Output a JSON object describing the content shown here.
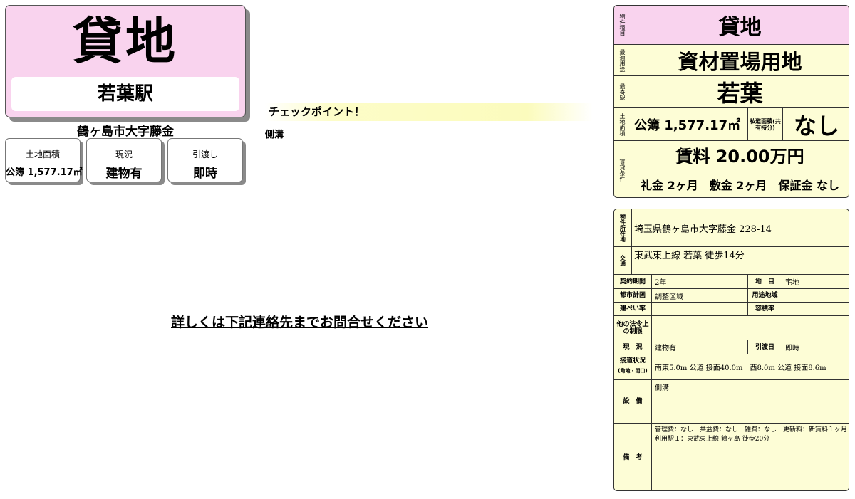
{
  "hero": {
    "type": "貸地",
    "station": "若葉駅",
    "address": "鶴ヶ島市大字藤金"
  },
  "mini_cards": [
    {
      "label": "土地面積",
      "value": "公簿 1,577.17㎡"
    },
    {
      "label": "現況",
      "value": "建物有"
    },
    {
      "label": "引渡し",
      "value": "即時"
    }
  ],
  "checkpoint": {
    "title": "チェックポイント！",
    "body": "側溝"
  },
  "contact_text": "詳しくは下記連絡先までお問合せください",
  "summary": {
    "type_label": "物件種目",
    "type": "貸地",
    "use_label": "最適用途",
    "use": "資材置場用地",
    "station_label": "最寄駅",
    "station": "若葉",
    "area_label": "土地面積",
    "area": "公簿 1,577.17㎡",
    "private_road_label": "私道面積(共有持分)",
    "private_road": "なし",
    "terms_label": "賃貸条件",
    "rent": "賃料 20.00万円",
    "deposits": "礼金 2ヶ月　敷金 2ヶ月　保証金 なし"
  },
  "details": {
    "location_label": "物件所在地",
    "location": "埼玉県鶴ヶ島市大字藤金 228-14",
    "transport_label": "交通",
    "transport": "東武東上線 若葉 徒歩14分",
    "rows": {
      "contract_label": "契約期間",
      "contract": "2年",
      "chimoku_label": "地　目",
      "chimoku": "宅地",
      "city_plan_label": "都市計画",
      "city_plan": "調整区域",
      "zoning_label": "用途地域",
      "zoning": "",
      "bcr_label": "建ぺい率",
      "bcr": "",
      "far_label": "容積率",
      "far": "",
      "restrictions_label": "他の法令上の制限",
      "restrictions": "",
      "status_label": "現　況",
      "status": "建物有",
      "handover_label": "引渡日",
      "handover": "即時",
      "road_label": "接道状況",
      "road_sub": "(角地・間口)",
      "road": "南東5.0m 公道 接面40.0m　西8.0m 公道 接面8.6m",
      "facilities_label": "設　備",
      "facilities": "側溝",
      "remarks_label": "備　考",
      "remarks": "管理費：なし　共益費：なし　雑費：なし　更新料：新賃料１ヶ月　利用駅１：東武東上線 鶴ヶ島 徒歩20分"
    }
  }
}
